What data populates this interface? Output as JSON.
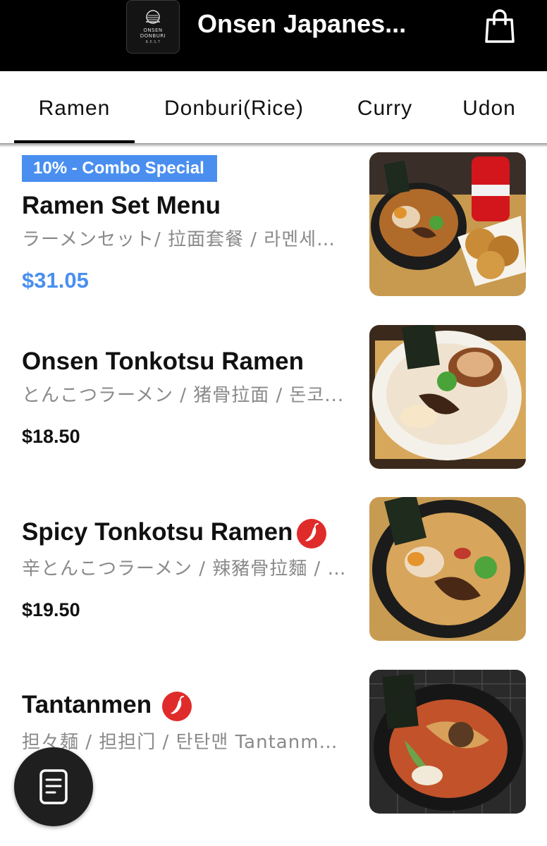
{
  "header": {
    "title": "Onsen Japanes...",
    "logo": {
      "line1": "ONSEN",
      "line2": "DONBURI",
      "line3": "B.E.S.T"
    },
    "cart_icon": "shopping-bag-icon"
  },
  "tabs": [
    {
      "label": "Ramen",
      "active": true
    },
    {
      "label": "Donburi(Rice)",
      "active": false
    },
    {
      "label": "Curry",
      "active": false
    },
    {
      "label": "Udon",
      "active": false
    }
  ],
  "items": [
    {
      "badge": "10% - Combo Special",
      "name": "Ramen Set Menu",
      "subtitle": "ラーメンセット/ 拉面套餐 / 라멘세트...",
      "price": "$31.05",
      "spicy": false
    },
    {
      "name": "Onsen Tonkotsu Ramen",
      "subtitle": "とんこつラーメン / 猪骨拉面 / 돈코...",
      "price": "$18.50",
      "spicy": false
    },
    {
      "name": "Spicy Tonkotsu Ramen",
      "subtitle": "辛とんこつラーメン / 辣豬骨拉麵 / ...",
      "price": "$19.50",
      "spicy": true
    },
    {
      "name": "Tantanmen",
      "subtitle": "担々麺 / 担担门 / 탄탄맨 Tantanmen ...",
      "spicy": true
    }
  ],
  "colors": {
    "accent": "#4a8ff0",
    "header_bg": "#000000",
    "chili": "#e02b2b"
  },
  "floating_button": {
    "icon": "receipt-icon"
  }
}
